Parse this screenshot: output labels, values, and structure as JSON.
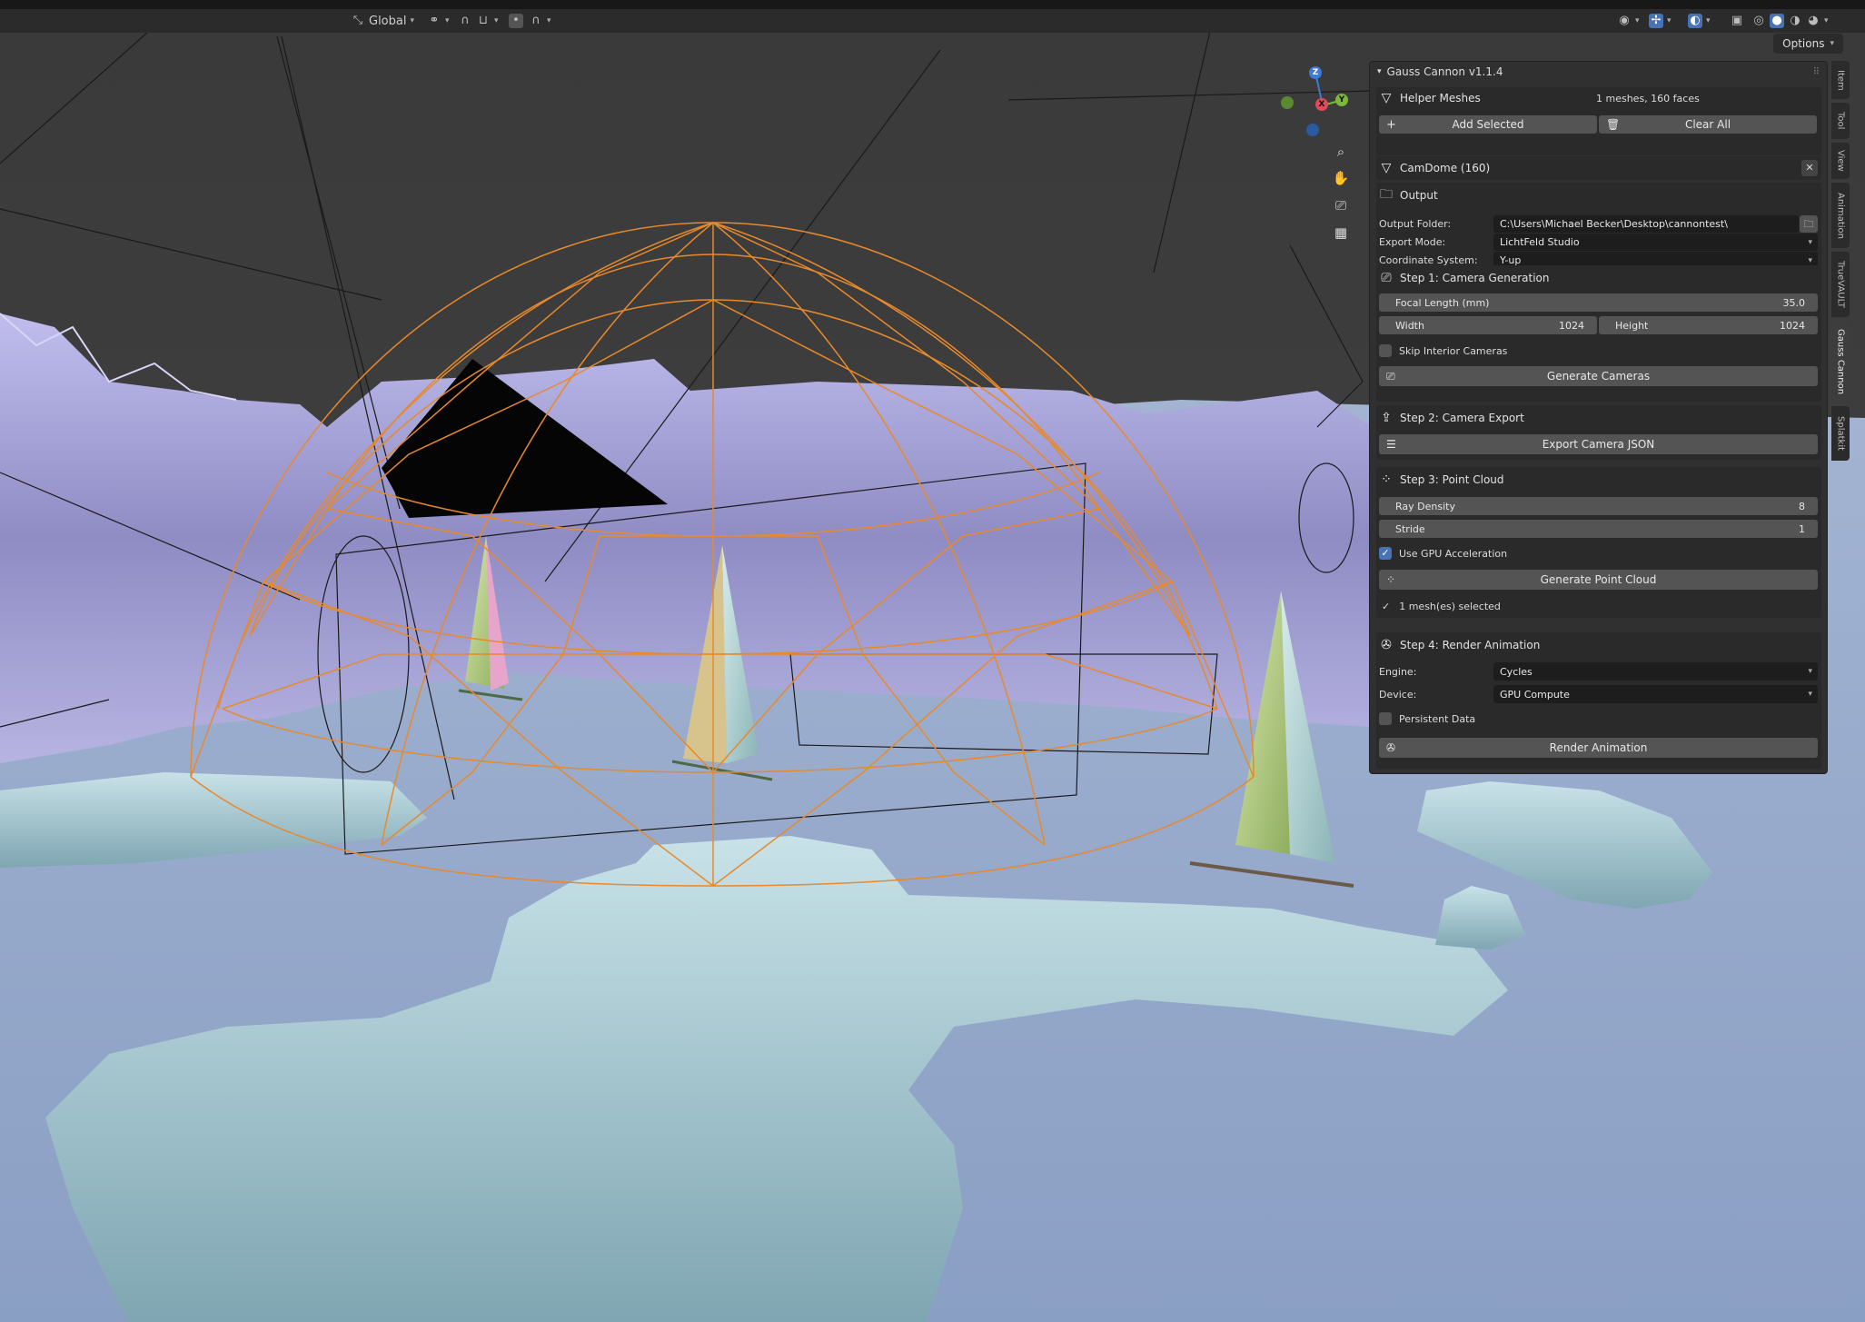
{
  "header": {
    "transform_orientation": "Global",
    "options_label": "Options"
  },
  "gizmo": {
    "x": "X",
    "y": "Y",
    "z": "Z"
  },
  "panel": {
    "title": "Gauss Cannon v1.1.4",
    "helper_meshes": {
      "label": "Helper Meshes",
      "summary": "1 meshes, 160 faces",
      "add_selected": "Add Selected",
      "clear_all": "Clear All",
      "mesh_item": "CamDome (160)"
    },
    "output": {
      "label": "Output",
      "folder_label": "Output Folder:",
      "folder_value": "C:\\Users\\Michael Becker\\Desktop\\cannontest\\",
      "export_mode_label": "Export Mode:",
      "export_mode_value": "LichtFeld Studio",
      "coord_label": "Coordinate System:",
      "coord_value": "Y-up"
    },
    "step1": {
      "label": "Step 1: Camera Generation",
      "focal_label": "Focal Length (mm)",
      "focal_value": "35.0",
      "width_label": "Width",
      "width_value": "1024",
      "height_label": "Height",
      "height_value": "1024",
      "skip_interior": "Skip Interior Cameras",
      "skip_interior_checked": false,
      "generate": "Generate Cameras"
    },
    "step2": {
      "label": "Step 2: Camera Export",
      "export": "Export Camera JSON"
    },
    "step3": {
      "label": "Step 3: Point Cloud",
      "ray_density_label": "Ray Density",
      "ray_density_value": "8",
      "stride_label": "Stride",
      "stride_value": "1",
      "use_gpu": "Use GPU Acceleration",
      "use_gpu_checked": true,
      "generate": "Generate Point Cloud",
      "status": "1 mesh(es) selected"
    },
    "step4": {
      "label": "Step 4: Render Animation",
      "engine_label": "Engine:",
      "engine_value": "Cycles",
      "device_label": "Device:",
      "device_value": "GPU Compute",
      "persistent": "Persistent Data",
      "persistent_checked": false,
      "render": "Render Animation"
    }
  },
  "sidebar_tabs": [
    "Item",
    "Tool",
    "View",
    "Animation",
    "TrueVAULT",
    "Gauss Cannon",
    "Splatkit"
  ],
  "active_tab": "Gauss Cannon",
  "colors": {
    "accent": "#4772b3",
    "dome": "#e8892b",
    "ocean": "#92a6c8",
    "ice": "#9ec2cc",
    "cliffs": "#a7a5d8"
  }
}
